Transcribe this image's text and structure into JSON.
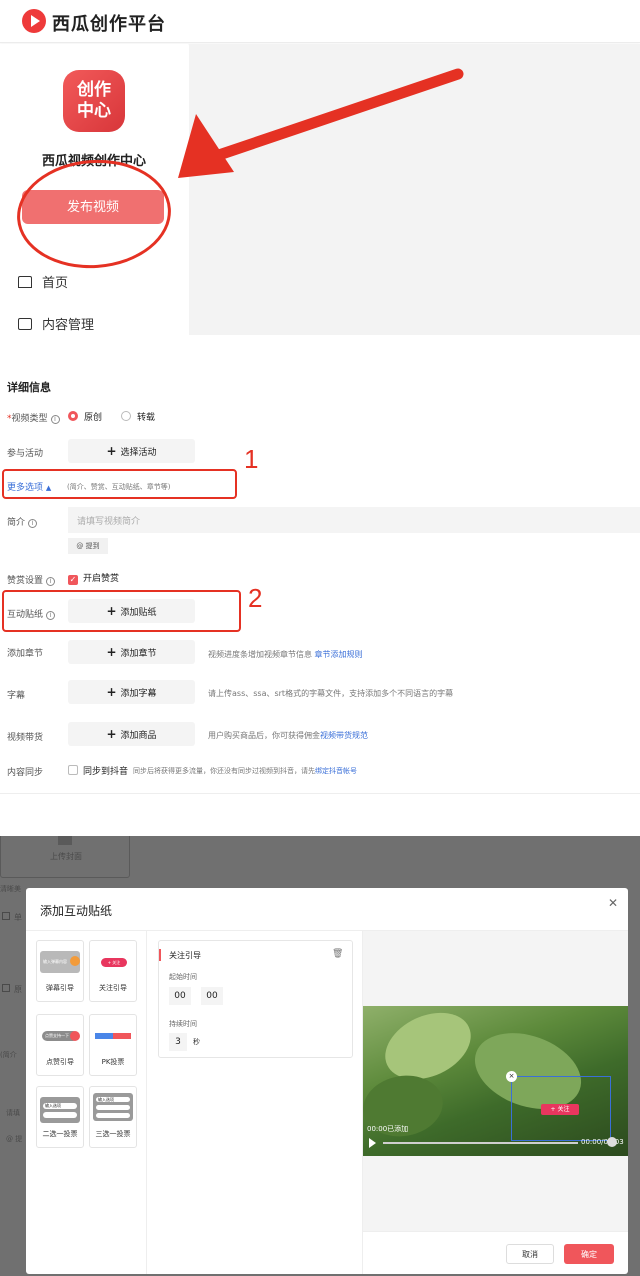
{
  "header": {
    "logo_text": "西瓜创作平台"
  },
  "sidebar": {
    "brand_logo_text": "创作\n中心",
    "brand_name": "西瓜视频创作中心",
    "publish_label": "发布视频",
    "nav": [
      {
        "label": "首页",
        "icon": "home-icon"
      },
      {
        "label": "内容管理",
        "icon": "video-icon"
      }
    ]
  },
  "annotations": {
    "n1": "1",
    "n2": "2",
    "accent": "#e53123"
  },
  "form": {
    "title": "详细信息",
    "video_type_label": "视频类型",
    "radio_original": "原创",
    "radio_repost": "转载",
    "activity_label": "参与活动",
    "activity_btn": "选择活动",
    "more_options": "更多选项",
    "more_options_hint": "(简介、赞赏、互动贴纸、章节等)",
    "intro_label": "简介",
    "intro_placeholder": "请填写视频简介",
    "mention_btn": "@ 提到",
    "reward_label": "赞赏设置",
    "reward_check": "开启赞赏",
    "sticker_label": "互动贴纸",
    "sticker_btn": "添加贴纸",
    "chapter_label": "添加章节",
    "chapter_btn": "添加章节",
    "chapter_hint": "视频进度条增加视频章节信息",
    "chapter_link": "章节添加规则",
    "subtitle_label": "字幕",
    "subtitle_btn": "添加字幕",
    "subtitle_hint": "请上传ass、ssa、srt格式的字幕文件，支持添加多个不同语言的字幕",
    "goods_label": "视频带货",
    "goods_btn": "添加商品",
    "goods_hint": "用户购买商品后，你可获得佣金",
    "goods_link": "视频带货规范",
    "sync_label": "内容同步",
    "sync_check": "同步到抖音",
    "sync_hint": "同步后将获得更多流量，你还没有同步过视频到抖音，请先",
    "sync_link": "绑定抖音帐号"
  },
  "background": {
    "upload_cover": "上传封面",
    "bg_text1": "清晰美",
    "bg_text2": "单",
    "bg_text3": "原",
    "bg_text4": "(简介",
    "bg_text5": "请填",
    "bg_text6": "@ 提"
  },
  "modal": {
    "title": "添加互动贴纸",
    "stickers": [
      {
        "label": "弹幕引导",
        "thumb_text": "输入弹幕内容"
      },
      {
        "label": "关注引导",
        "thumb_text": "+ 关注"
      },
      {
        "label": "点赞引导",
        "thumb_text": "点赞支持一下"
      },
      {
        "label": "PK投票",
        "thumb_text": ""
      },
      {
        "label": "二选一投票",
        "thumb_text": "输入选项"
      },
      {
        "label": "三选一投票",
        "thumb_text": "输入选项"
      }
    ],
    "config": {
      "name": "关注引导",
      "start_label": "起始时间",
      "start_min": "00",
      "start_sec": "00",
      "duration_label": "持续时间",
      "duration_value": "3",
      "duration_unit": "秒"
    },
    "preview": {
      "follow_badge": "+ 关注",
      "time_left": "00:00已添加",
      "time_right": "00:00/00:03"
    },
    "cancel": "取消",
    "confirm": "确定",
    "confirm_color": "#f0565b"
  }
}
